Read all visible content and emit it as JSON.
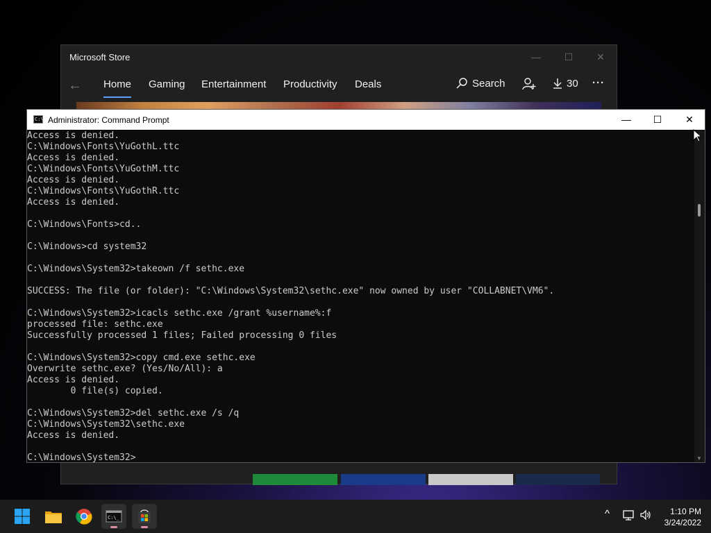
{
  "store": {
    "title": "Microsoft Store",
    "tabs": [
      "Home",
      "Gaming",
      "Entertainment",
      "Productivity",
      "Deals"
    ],
    "search_label": "Search",
    "downloads_count": "30",
    "minimize_glyph": "—",
    "maximize_glyph": "☐",
    "close_glyph": "✕",
    "back_glyph": "←",
    "more_glyph": "···"
  },
  "cmd": {
    "title": "Administrator: Command Prompt",
    "icon_text": "C:\\",
    "minimize_glyph": "—",
    "maximize_glyph": "☐",
    "close_glyph": "✕",
    "lines": [
      "Access is denied.",
      "C:\\Windows\\Fonts\\YuGothL.ttc",
      "Access is denied.",
      "C:\\Windows\\Fonts\\YuGothM.ttc",
      "Access is denied.",
      "C:\\Windows\\Fonts\\YuGothR.ttc",
      "Access is denied.",
      "",
      "C:\\Windows\\Fonts>cd..",
      "",
      "C:\\Windows>cd system32",
      "",
      "C:\\Windows\\System32>takeown /f sethc.exe",
      "",
      "SUCCESS: The file (or folder): \"C:\\Windows\\System32\\sethc.exe\" now owned by user \"COLLABNET\\VM6\".",
      "",
      "C:\\Windows\\System32>icacls sethc.exe /grant %username%:f",
      "processed file: sethc.exe",
      "Successfully processed 1 files; Failed processing 0 files",
      "",
      "C:\\Windows\\System32>copy cmd.exe sethc.exe",
      "Overwrite sethc.exe? (Yes/No/All): a",
      "Access is denied.",
      "        0 file(s) copied.",
      "",
      "C:\\Windows\\System32>del sethc.exe /s /q",
      "C:\\Windows\\System32\\sethc.exe",
      "Access is denied.",
      "",
      "C:\\Windows\\System32>"
    ]
  },
  "taskbar": {
    "apps": [
      {
        "name": "start-button",
        "icon": "windows-logo-icon"
      },
      {
        "name": "file-explorer",
        "icon": "folder-icon"
      },
      {
        "name": "chrome",
        "icon": "chrome-icon"
      },
      {
        "name": "command-prompt",
        "icon": "cmd-icon"
      },
      {
        "name": "microsoft-store",
        "icon": "store-icon"
      }
    ],
    "tray": {
      "chevron": "^",
      "time": "1:10 PM",
      "date": "3/24/2022"
    }
  },
  "colors": {
    "store_accent": "#60a0ff",
    "cmd_text": "#cccccc",
    "cmd_bg": "#0c0c0c",
    "taskbar_bg": "#1c1c1c"
  }
}
